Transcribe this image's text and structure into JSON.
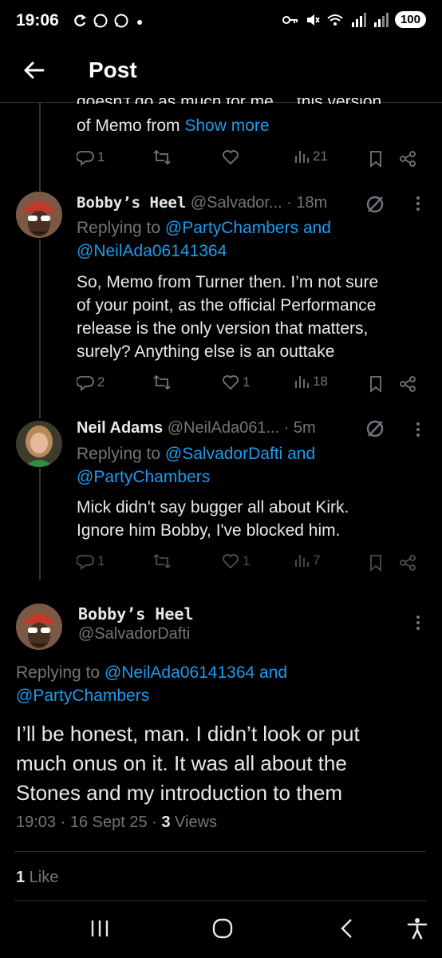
{
  "status_bar": {
    "time": "19:06",
    "battery": "100",
    "left_icons": [
      "sync-icon",
      "whatsapp-icon",
      "whatsapp-icon",
      "dot-icon"
    ],
    "right_icons": [
      "key-icon",
      "mute-icon",
      "wifi-icon",
      "signal-icon",
      "signal-icon"
    ]
  },
  "header": {
    "title": "Post"
  },
  "truncated_post": {
    "cut_line": "doesn't do as much for me.... this version",
    "text_start": "of Memo from ",
    "show_more": "Show more",
    "stats": {
      "replies": "1",
      "reposts": "",
      "likes": "",
      "views": "21"
    }
  },
  "replies": [
    {
      "display_name": "Bobby’s Heel",
      "handle": "@Salvador...",
      "time": "· 18m",
      "replying_prefix": "Replying to ",
      "replying_to": "@PartyChambers and @NeilAda06141364",
      "replying_line1": "@PartyChambers and",
      "replying_line2": "@NeilAda06141364",
      "lines": [
        "So, Memo from Turner then. I’m not sure",
        "of your point, as the official Performance",
        "release is the only version that matters,",
        "surely? Anything else is an outtake"
      ],
      "stats": {
        "replies": "2",
        "reposts": "",
        "likes": "1",
        "views": "18"
      }
    },
    {
      "display_name": "Neil Adams",
      "handle": "@NeilAda061...",
      "time": "· 5m",
      "replying_prefix": "Replying to ",
      "replying_line1": "@SalvadorDafti and",
      "replying_line2": "@PartyChambers",
      "lines": [
        "Mick didn't say bugger all about Kirk.",
        "Ignore him Bobby, I've blocked him."
      ],
      "stats": {
        "replies": "1",
        "reposts": "",
        "likes": "1",
        "views": "7"
      }
    }
  ],
  "main_post": {
    "display_name": "Bobby’s Heel",
    "handle": "@SalvadorDafti",
    "replying_prefix": "Replying to ",
    "replying_line1": "@NeilAda06141364 and",
    "replying_line2": "@PartyChambers",
    "lines": [
      "I’ll be honest, man. I didn’t look or put",
      "much onus on it. It was all about the",
      "Stones and my introduction to them"
    ],
    "timestamp": "19:03 · 16 Sept 25 · ",
    "views_count": "3",
    "views_label": " Views",
    "likes_count": "1",
    "likes_label": " Like"
  },
  "colors": {
    "background": "#000000",
    "text": "#e7e9ea",
    "muted": "#71767b",
    "link": "#1d9bf0",
    "divider": "#2f3336"
  }
}
